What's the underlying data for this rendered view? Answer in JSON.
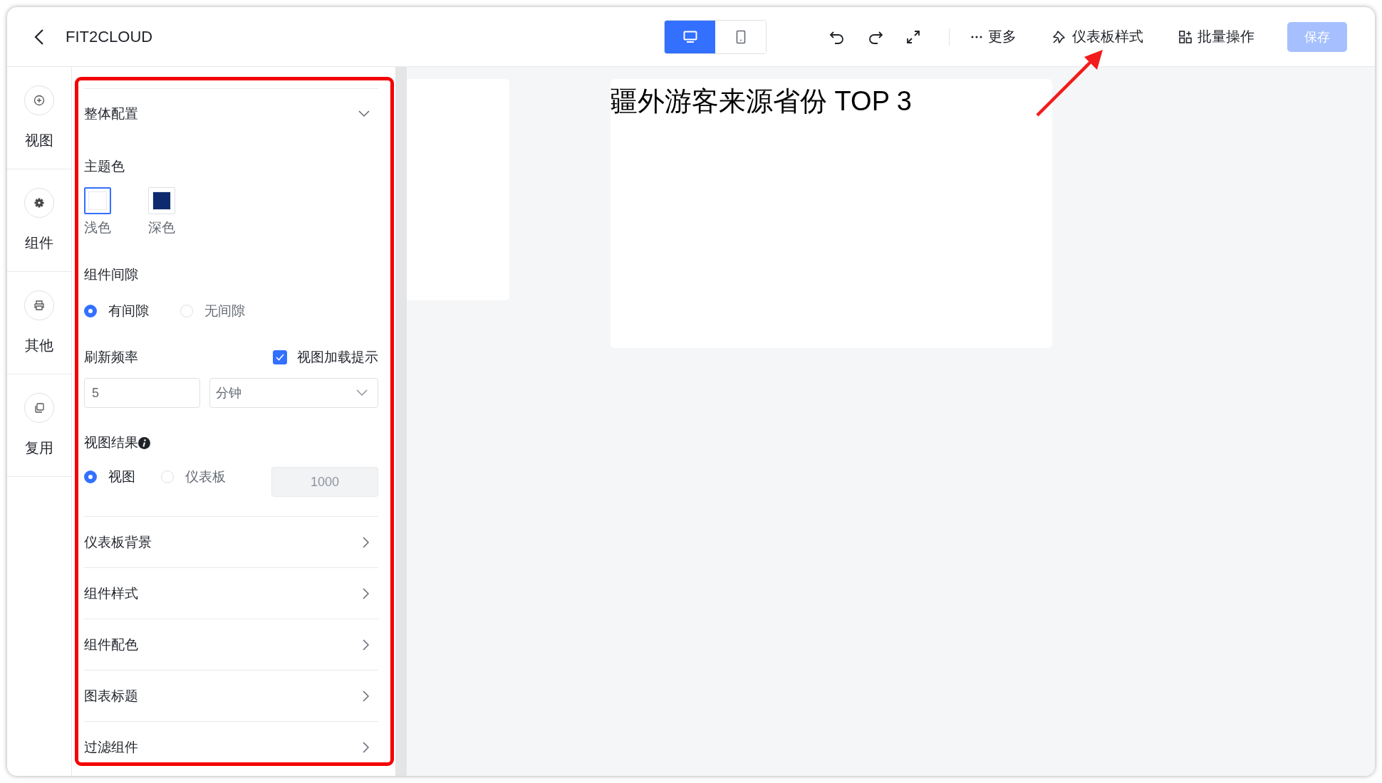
{
  "header": {
    "title": "FIT2CLOUD",
    "device_toggle": [
      {
        "kind": "desktop",
        "selected": true
      },
      {
        "kind": "mobile",
        "selected": false
      }
    ],
    "actions": [
      {
        "kind": "more",
        "label": "更多"
      },
      {
        "kind": "style",
        "label": "仪表板样式"
      },
      {
        "kind": "batch",
        "label": "批量操作"
      }
    ],
    "save": {
      "label": "保存",
      "disabled": true
    }
  },
  "rail": [
    {
      "kind": "add",
      "label": "视图"
    },
    {
      "kind": "gear",
      "label": "组件"
    },
    {
      "kind": "other",
      "label": "其他"
    },
    {
      "kind": "copy",
      "label": "复用"
    }
  ],
  "panel": {
    "section": {
      "title": "整体配置",
      "expanded": true
    },
    "theme": {
      "label": "主题色",
      "options": [
        {
          "label": "浅色",
          "color": "#ffffff",
          "selected": true
        },
        {
          "label": "深色",
          "color": "#0e2a6e",
          "selected": false
        }
      ]
    },
    "gap": {
      "label": "组件间隙",
      "options": [
        {
          "label": "有间隙",
          "selected": true
        },
        {
          "label": "无间隙",
          "selected": false
        }
      ]
    },
    "refresh": {
      "label": "刷新频率",
      "hint": {
        "label": "视图加载提示",
        "checked": true
      },
      "value": "5",
      "unit": "分钟"
    },
    "result": {
      "label": "视图结果",
      "options": [
        {
          "label": "视图",
          "selected": true
        },
        {
          "label": "仪表板",
          "selected": false
        }
      ],
      "limit": "1000"
    },
    "collapsed_sections": [
      {
        "title": "仪表板背景",
        "expanded": false
      },
      {
        "title": "组件样式",
        "expanded": false
      },
      {
        "title": "组件配色",
        "expanded": false
      },
      {
        "title": "图表标题",
        "expanded": false
      },
      {
        "title": "过滤组件",
        "expanded": false
      }
    ]
  },
  "canvas": {
    "widgets": [
      {
        "kind": "blank"
      },
      {
        "kind": "titled",
        "title": "疆外游客来源省份 TOP 3"
      }
    ]
  },
  "annotations": {
    "highlight_frame": true,
    "arrow": true
  }
}
